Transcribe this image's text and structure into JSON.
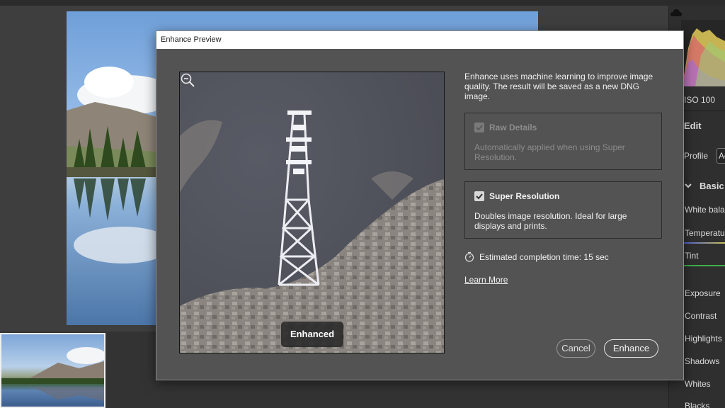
{
  "dialog": {
    "title": "Enhance Preview",
    "description": "Enhance uses machine learning to improve image quality. The result will be saved as a new DNG image.",
    "preview_badge": "Enhanced",
    "raw_details": {
      "label": "Raw Details",
      "checked": true,
      "disabled": true,
      "description": "Automatically applied when using Super Resolution."
    },
    "super_resolution": {
      "label": "Super Resolution",
      "checked": true,
      "description": "Doubles image resolution. Ideal for large displays and prints."
    },
    "estimate": "Estimated completion time: 15 sec",
    "learn_more": "Learn More",
    "cancel_label": "Cancel",
    "enhance_label": "Enhance"
  },
  "right_panel": {
    "iso": "ISO 100",
    "edit": "Edit",
    "profile": "Profile",
    "profile_value": "Ad",
    "basic": "Basic",
    "white_balance": "White balan",
    "temperature": "Temperatur",
    "tint": "Tint",
    "exposure": "Exposure",
    "contrast": "Contrast",
    "highlights": "Highlights",
    "shadows": "Shadows",
    "whites": "Whites",
    "blacks": "Blacks"
  },
  "icons": {
    "cloud": "cloud-icon",
    "zoom": "zoom-out-icon",
    "timer": "stopwatch-icon",
    "check": "checkmark-icon",
    "chevron": "chevron-down-icon"
  },
  "colors": {
    "dialog_bg": "#535353",
    "temperature_track": "#4a5fd6",
    "tint_track": "#3fae4a"
  }
}
